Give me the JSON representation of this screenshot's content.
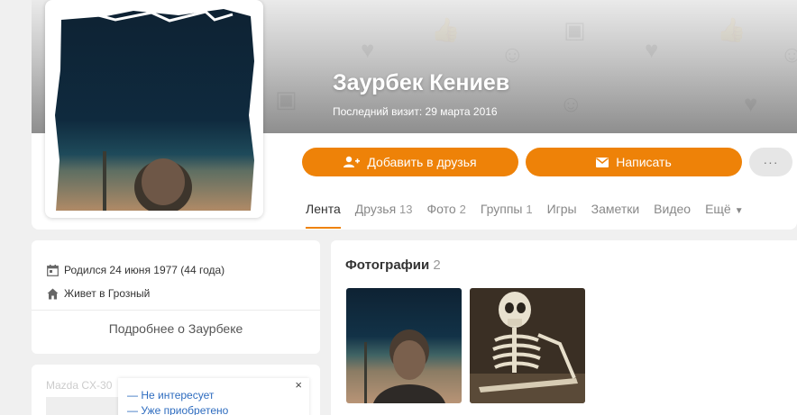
{
  "profile": {
    "name": "Заурбек Кениев",
    "last_visit": "Последний визит: 29 марта 2016"
  },
  "actions": {
    "add_friend": "Добавить в друзья",
    "write": "Написать",
    "more": "···"
  },
  "tabs": [
    {
      "label": "Лента",
      "count": ""
    },
    {
      "label": "Друзья",
      "count": "13"
    },
    {
      "label": "Фото",
      "count": "2"
    },
    {
      "label": "Группы",
      "count": "1"
    },
    {
      "label": "Игры",
      "count": ""
    },
    {
      "label": "Заметки",
      "count": ""
    },
    {
      "label": "Видео",
      "count": ""
    },
    {
      "label": "Ещё",
      "count": ""
    }
  ],
  "info": {
    "birth": "Родился 24 июня 1977 (44 года)",
    "lives": "Живет в Грозный",
    "more_link": "Подробнее о Заурбеке"
  },
  "ad": {
    "faded_title": "Mazda CX-30",
    "option1": "— Не интересует",
    "option2": "— Уже приобретено",
    "close": "×"
  },
  "photos": {
    "title": "Фотографии",
    "count": "2"
  },
  "colors": {
    "accent": "#ee8208",
    "link": "#2e6cbf"
  }
}
